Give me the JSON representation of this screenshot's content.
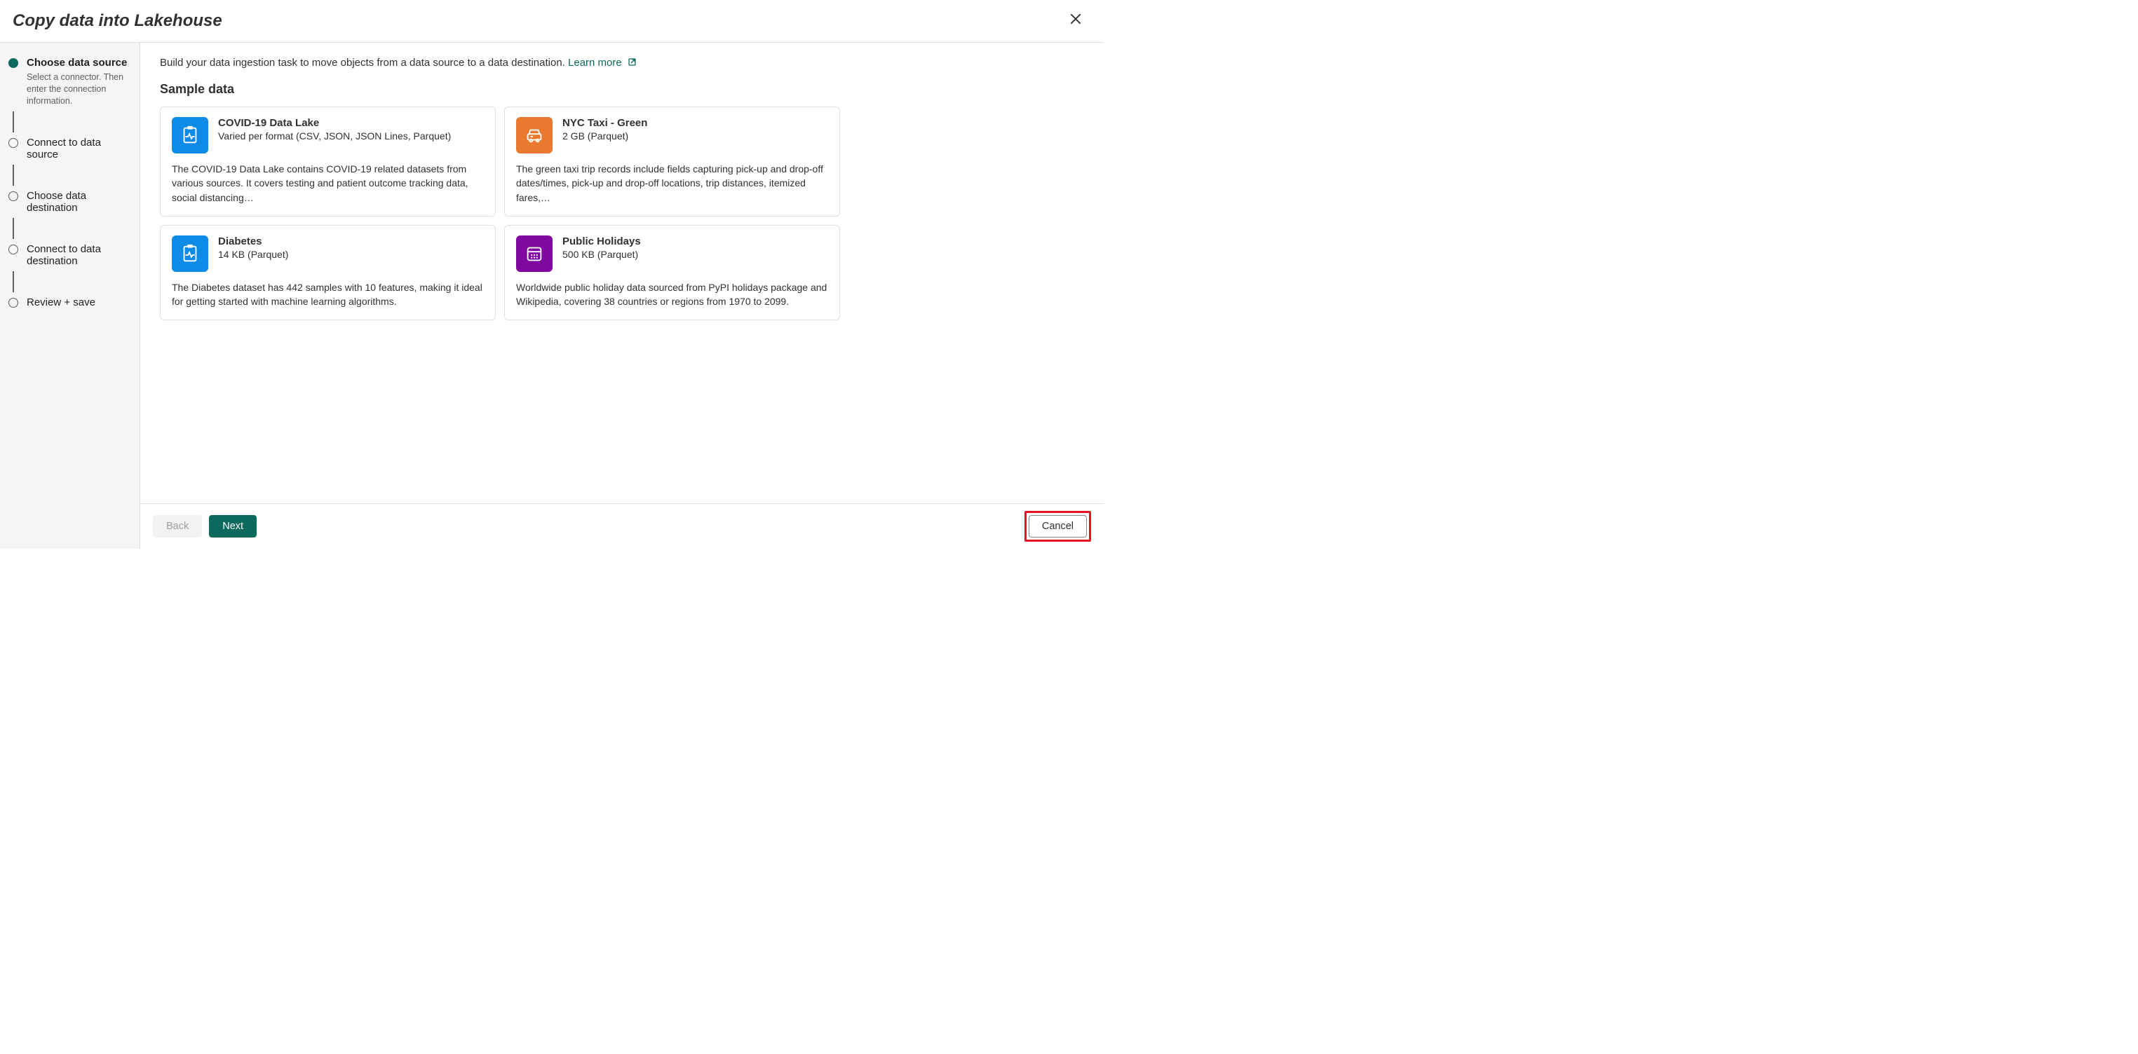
{
  "header": {
    "title": "Copy data into Lakehouse"
  },
  "steps": [
    {
      "title": "Choose data source",
      "desc": "Select a connector. Then enter the connection information.",
      "active": true
    },
    {
      "title": "Connect to data source"
    },
    {
      "title": "Choose data destination"
    },
    {
      "title": "Connect to data destination"
    },
    {
      "title": "Review + save"
    }
  ],
  "main": {
    "intro_text": "Build your data ingestion task to move objects from a data source to a data destination. ",
    "learn_more": "Learn more",
    "section_title": "Sample data",
    "cards": [
      {
        "icon": "clipboard-pulse",
        "icon_color": "blue",
        "title": "COVID-19 Data Lake",
        "subtitle": "Varied per format (CSV, JSON, JSON Lines, Parquet)",
        "desc": "The COVID-19 Data Lake contains COVID-19 related datasets from various sources. It covers testing and patient outcome tracking data, social distancing…"
      },
      {
        "icon": "taxi",
        "icon_color": "orange",
        "title": "NYC Taxi - Green",
        "subtitle": "2 GB (Parquet)",
        "desc": "The green taxi trip records include fields capturing pick-up and drop-off dates/times, pick-up and drop-off locations, trip distances, itemized fares,…"
      },
      {
        "icon": "clipboard-pulse",
        "icon_color": "blue",
        "title": "Diabetes",
        "subtitle": "14 KB (Parquet)",
        "desc": "The Diabetes dataset has 442 samples with 10 features, making it ideal for getting started with machine learning algorithms."
      },
      {
        "icon": "calendar",
        "icon_color": "purple",
        "title": "Public Holidays",
        "subtitle": "500 KB (Parquet)",
        "desc": "Worldwide public holiday data sourced from PyPI holidays package and Wikipedia, covering 38 countries or regions from 1970 to 2099."
      }
    ]
  },
  "footer": {
    "back": "Back",
    "next": "Next",
    "cancel": "Cancel"
  }
}
